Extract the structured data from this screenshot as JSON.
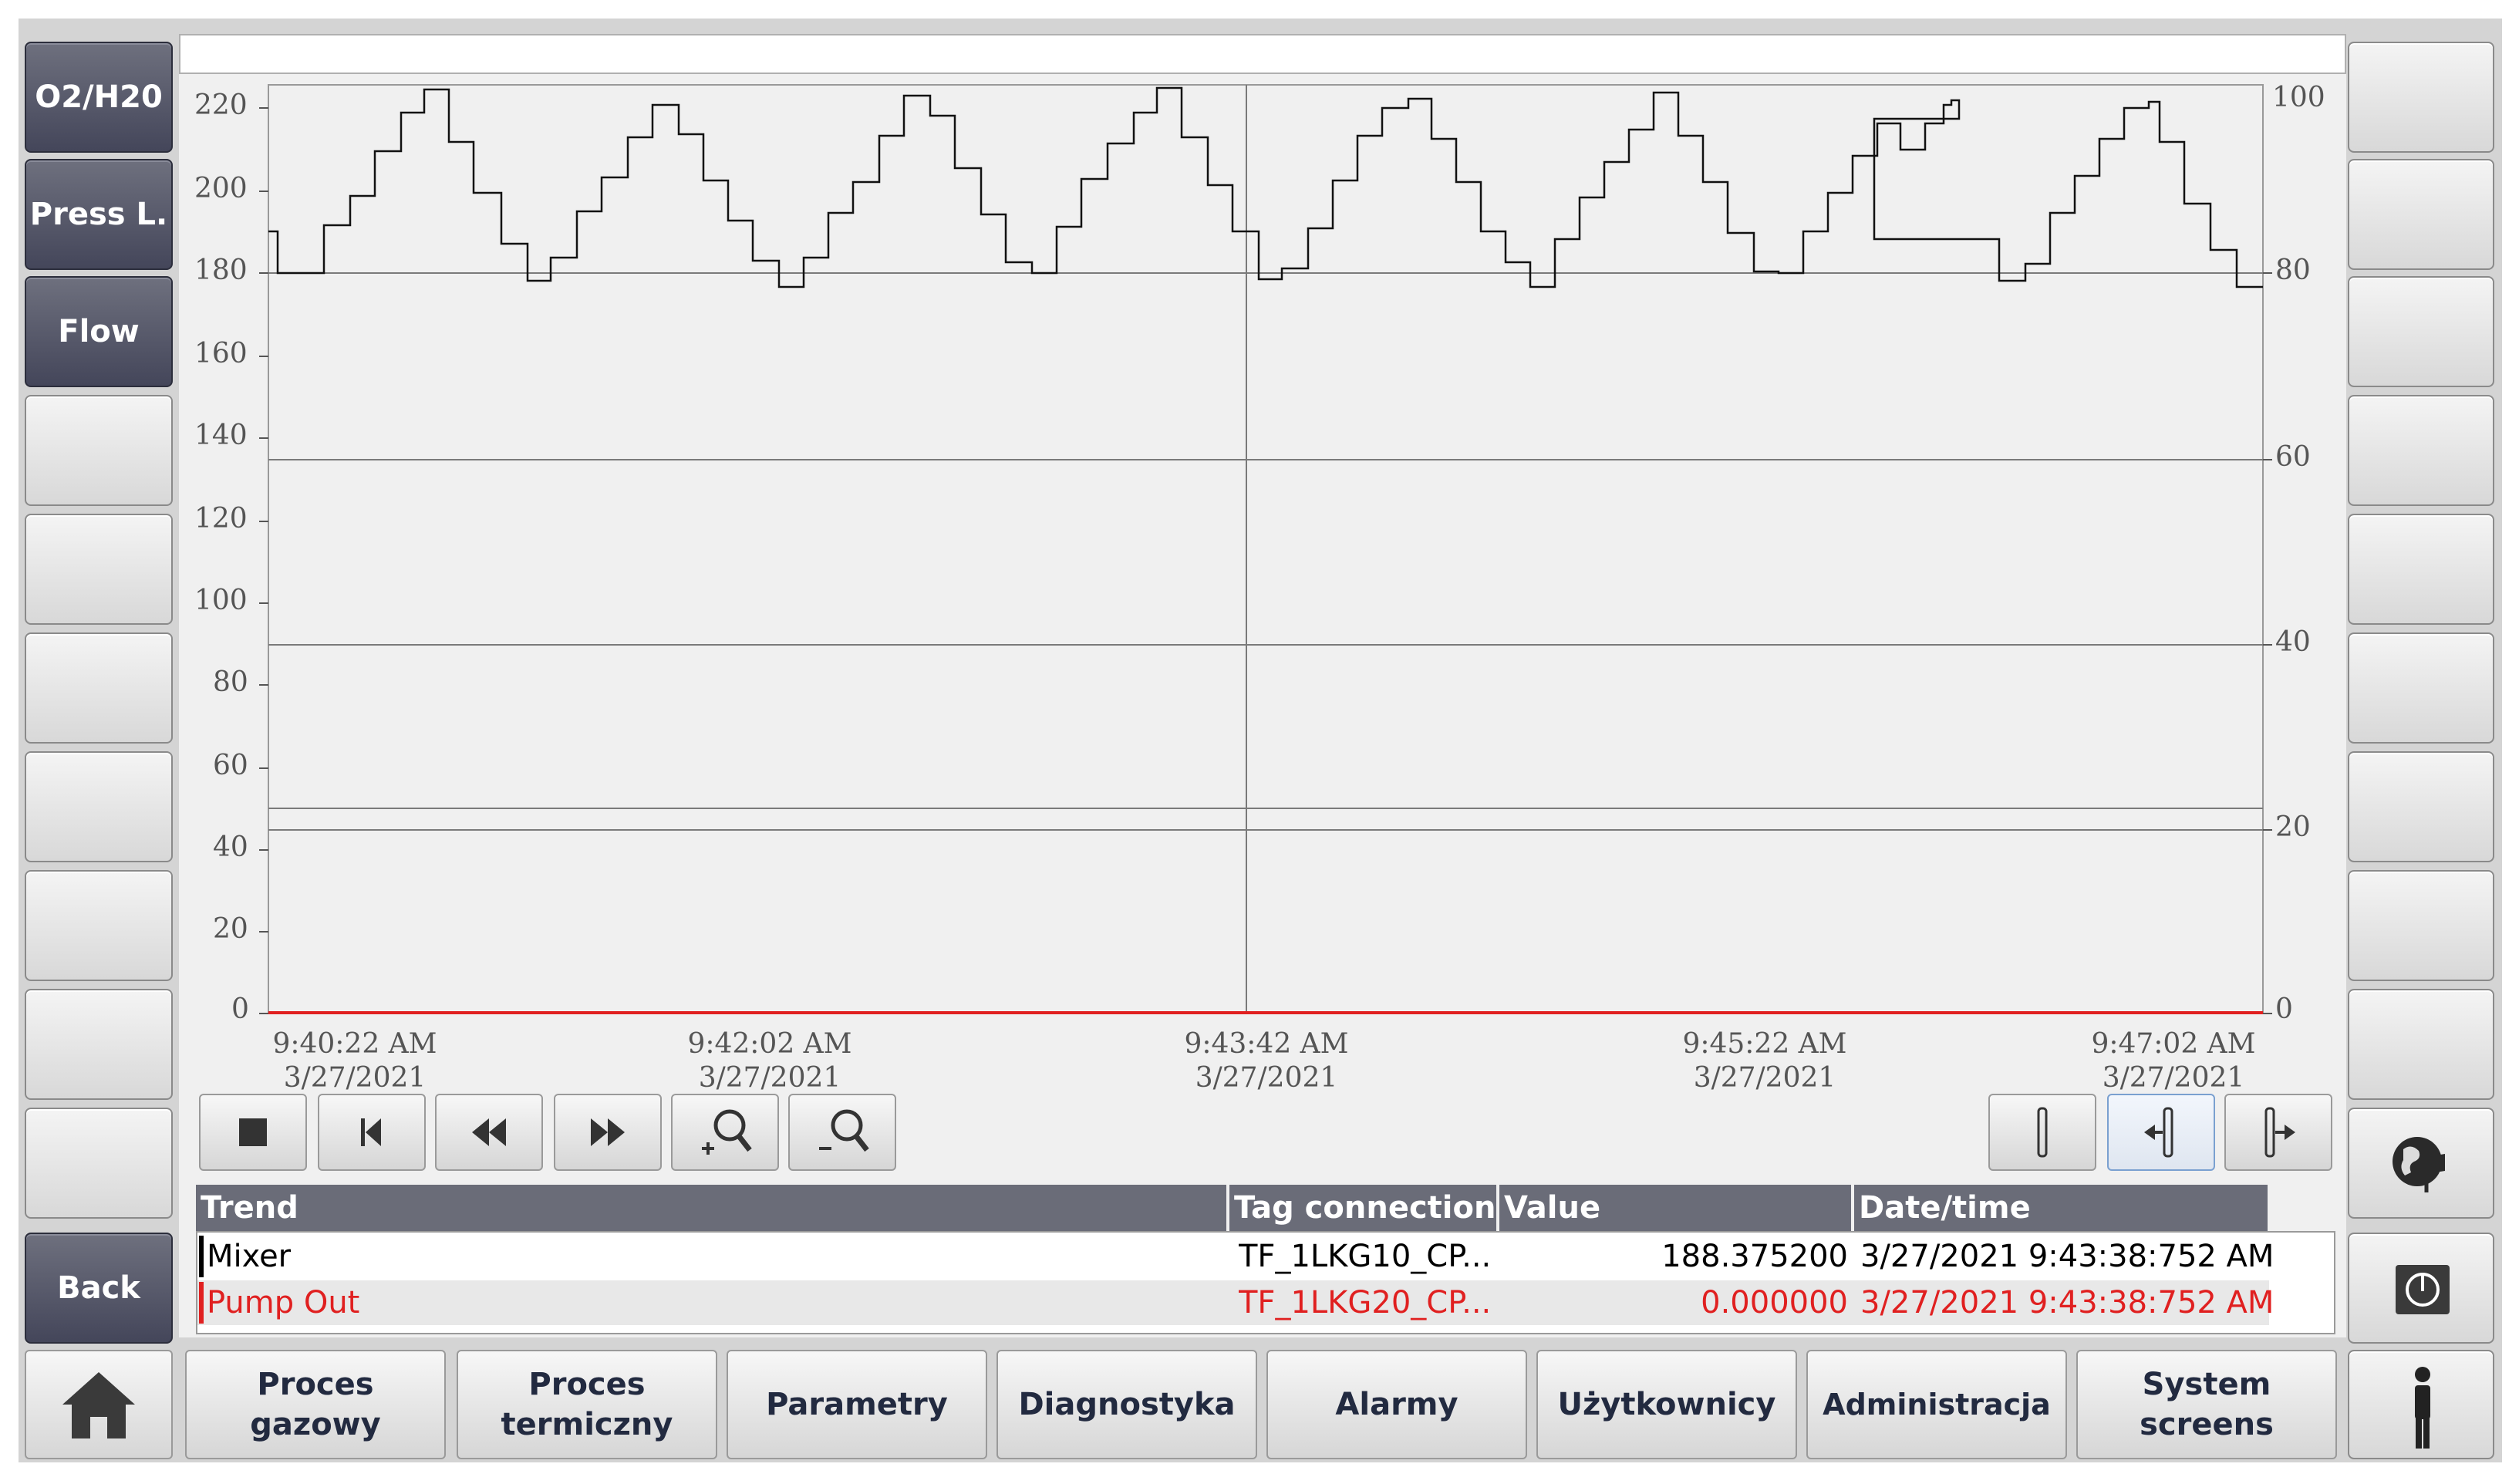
{
  "left_buttons": [
    {
      "label": "O2/H20"
    },
    {
      "label": "Press L."
    },
    {
      "label": "Flow"
    },
    {
      "label": ""
    },
    {
      "label": ""
    },
    {
      "label": ""
    },
    {
      "label": ""
    },
    {
      "label": ""
    },
    {
      "label": ""
    },
    {
      "label": ""
    },
    {
      "label": "Back"
    }
  ],
  "trend": {
    "left_axis_ticks": [
      "220",
      "200",
      "180",
      "160",
      "140",
      "120",
      "100",
      "80",
      "60",
      "40",
      "20",
      "0"
    ],
    "right_axis_ticks": [
      "100",
      "80",
      "60",
      "40",
      "20",
      "0"
    ],
    "time_labels": [
      {
        "time": "9:40:22 AM",
        "date": "3/27/2021"
      },
      {
        "time": "9:42:02 AM",
        "date": "3/27/2021"
      },
      {
        "time": "9:43:42 AM",
        "date": "3/27/2021"
      },
      {
        "time": "9:45:22 AM",
        "date": "3/27/2021"
      },
      {
        "time": "9:47:02 AM",
        "date": "3/27/2021"
      }
    ],
    "series_colors": {
      "mixer": "#1a1a1a",
      "pump_out": "#e02020"
    }
  },
  "toolbar_icons": [
    "stop-icon",
    "first-icon",
    "rewind-icon",
    "forward-icon",
    "zoom-in-icon",
    "zoom-out-icon"
  ],
  "ruler_icons": [
    "ruler-icon",
    "ruler-left-icon",
    "ruler-right-icon"
  ],
  "table": {
    "headers": {
      "trend": "Trend",
      "tag": "Tag connection",
      "value": "Value",
      "datetime": "Date/time"
    },
    "rows": [
      {
        "trend": "Mixer",
        "tag": "TF_1LKG10_CP...",
        "value": "188.375200",
        "datetime": "3/27/2021 9:43:38:752 AM",
        "color": "#000000"
      },
      {
        "trend": "Pump Out",
        "tag": "TF_1LKG20_CP...",
        "value": "0.000000",
        "datetime": "3/27/2021 9:43:38:752 AM",
        "color": "#e02020"
      }
    ]
  },
  "bottom_nav": [
    {
      "label": "Proces\ngazowy"
    },
    {
      "label": "Proces\ntermiczny"
    },
    {
      "label": "Parametry"
    },
    {
      "label": "Diagnostyka"
    },
    {
      "label": "Alarmy"
    },
    {
      "label": "Użytkownicy"
    },
    {
      "label": "Administracja"
    },
    {
      "label": "System\nscreens"
    }
  ],
  "right_icons": [
    "language-icon",
    "power-icon",
    "user-icon"
  ]
}
